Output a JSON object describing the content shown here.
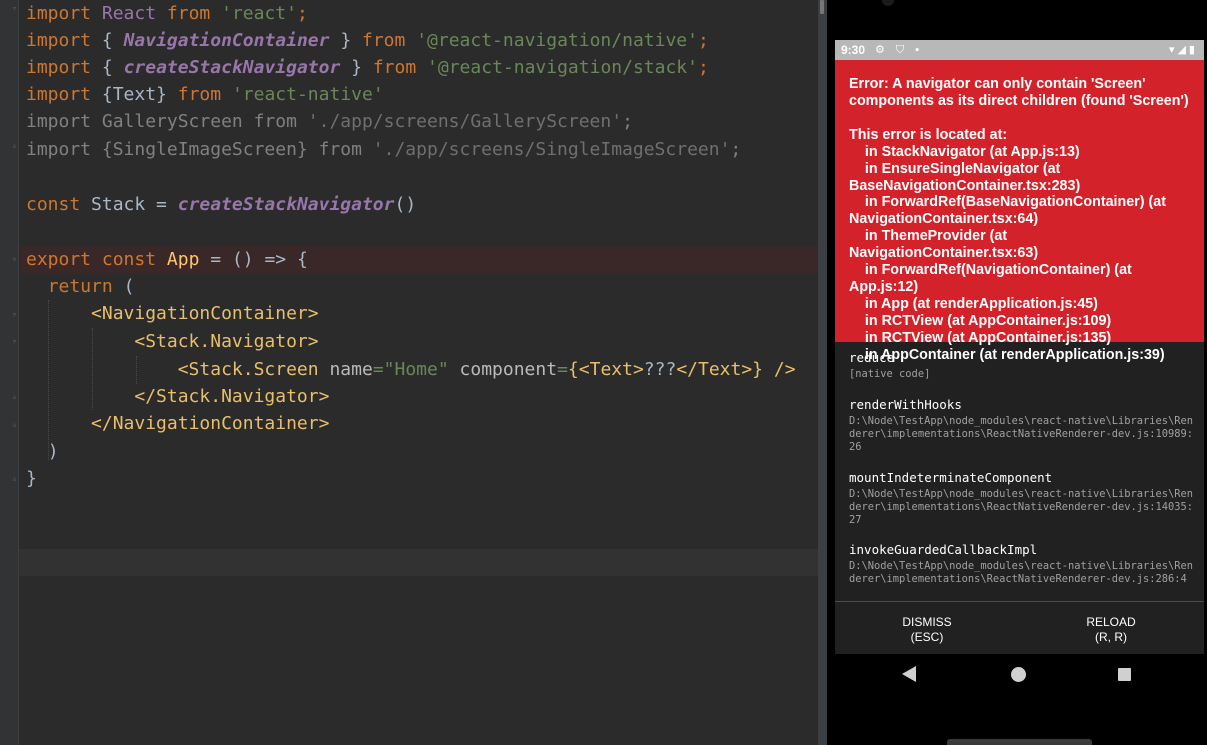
{
  "editor": {
    "lines": [
      [
        "import React from 'react';"
      ],
      [
        "import { NavigationContainer } from '@react-navigation/native';"
      ],
      [
        "import { createStackNavigator } from '@react-navigation/stack';"
      ],
      [
        "import {Text} from 'react-native'"
      ],
      [
        "import GalleryScreen from './app/screens/GalleryScreen';"
      ],
      [
        "import {SingleImageScreen} from './app/screens/SingleImageScreen';"
      ],
      [
        ""
      ],
      [
        "const Stack = createStackNavigator()"
      ],
      [
        ""
      ],
      [
        "export const App = () => {"
      ],
      [
        "  return ("
      ],
      [
        "      <NavigationContainer>"
      ],
      [
        "          <Stack.Navigator>"
      ],
      [
        "              <Stack.Screen name=\"Home\" component={<Text>???</Text>} />"
      ],
      [
        "          </Stack.Navigator>"
      ],
      [
        "      </NavigationContainer>"
      ],
      [
        "  )"
      ],
      [
        "}"
      ]
    ],
    "tokens": {
      "l1": [
        "import",
        "React",
        "from",
        "'react'",
        ";"
      ],
      "l2": [
        "import",
        "{",
        "NavigationContainer",
        "}",
        "from",
        "'@react-navigation/native'",
        ";"
      ],
      "l3": [
        "import",
        "{",
        "createStackNavigator",
        "}",
        "from",
        "'@react-navigation/stack'",
        ";"
      ],
      "l4": [
        "import",
        "{Text}",
        "from",
        "'react-native'"
      ],
      "l5": [
        "import GalleryScreen from",
        "'./app/screens/GalleryScreen'",
        ";"
      ],
      "l6": [
        "import {SingleImageScreen} from",
        "'./app/screens/SingleImageScreen'",
        ";"
      ],
      "l8": [
        "const",
        "Stack =",
        "createStackNavigator",
        "()"
      ],
      "l10": [
        "export",
        "const",
        "App",
        "= () => {"
      ],
      "l11": [
        "return",
        "("
      ],
      "l12": [
        "<NavigationContainer>"
      ],
      "l13": [
        "<Stack.Navigator>"
      ],
      "l14": [
        "<Stack.Screen",
        "name",
        "=",
        "\"Home\"",
        "component",
        "=",
        "{",
        "<Text>",
        "???",
        "</Text>",
        "}",
        "/>"
      ],
      "l15": [
        "</Stack.Navigator>"
      ],
      "l16": [
        "</NavigationContainer>"
      ],
      "l17": [
        ")"
      ],
      "l18": [
        "}"
      ]
    }
  },
  "device": {
    "status": {
      "time": "9:30",
      "left_icons": "⚙ ⛉ ▪",
      "right_icons": "▾◢▮"
    },
    "error": {
      "message": "Error: A navigator can only contain 'Screen' components as its direct children (found 'Screen')",
      "location_title": "This error is located at:",
      "frames": [
        "    in StackNavigator (at App.js:13)",
        "    in EnsureSingleNavigator (at BaseNavigationContainer.tsx:283)",
        "    in ForwardRef(BaseNavigationContainer) (at NavigationContainer.tsx:64)",
        "    in ThemeProvider (at NavigationContainer.tsx:63)",
        "    in ForwardRef(NavigationContainer) (at App.js:12)",
        "    in App (at renderApplication.js:45)",
        "    in RCTView (at AppContainer.js:109)",
        "    in RCTView (at AppContainer.js:135)",
        "    in AppContainer (at renderApplication.js:39)"
      ]
    },
    "stack": [
      {
        "name": "reduce",
        "file": "[native code]"
      },
      {
        "name": "renderWithHooks",
        "file": "D:\\Node\\TestApp\\node_modules\\react-native\\Libraries\\Renderer\\implementations\\ReactNativeRenderer-dev.js:10989:26"
      },
      {
        "name": "mountIndeterminateComponent",
        "file": "D:\\Node\\TestApp\\node_modules\\react-native\\Libraries\\Renderer\\implementations\\ReactNativeRenderer-dev.js:14035:27"
      },
      {
        "name": "invokeGuardedCallbackImpl",
        "file": "D:\\Node\\TestApp\\node_modules\\react-native\\Libraries\\Renderer\\implementations\\ReactNativeRenderer-dev.js:286:4"
      }
    ],
    "buttons": {
      "dismiss": "DISMISS",
      "dismiss_hint": "(ESC)",
      "reload": "RELOAD",
      "reload_hint": "(R, R)"
    }
  }
}
